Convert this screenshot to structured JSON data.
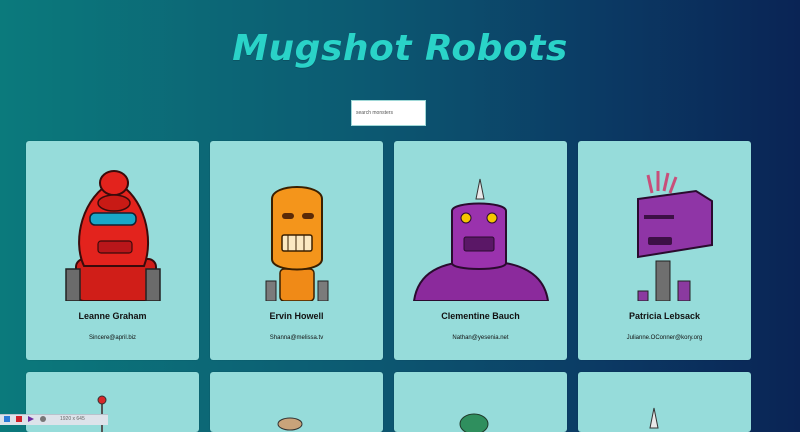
{
  "app": {
    "title": "Mugshot Robots"
  },
  "search": {
    "placeholder": "search monsters"
  },
  "robots": [
    {
      "name": "Leanne Graham",
      "email": "Sincere@april.biz"
    },
    {
      "name": "Ervin Howell",
      "email": "Shanna@melissa.tv"
    },
    {
      "name": "Clementine Bauch",
      "email": "Nathan@yesenia.net"
    },
    {
      "name": "Patricia Lebsack",
      "email": "Julianne.OConner@kory.org"
    }
  ],
  "colors": {
    "title": "#2ad3c8",
    "card": "#96dcda",
    "robot_red": "#e3231d",
    "robot_orange": "#f08a17",
    "robot_purple": "#8b2a9c"
  },
  "taskbar": {
    "text": "1920 x 645"
  }
}
